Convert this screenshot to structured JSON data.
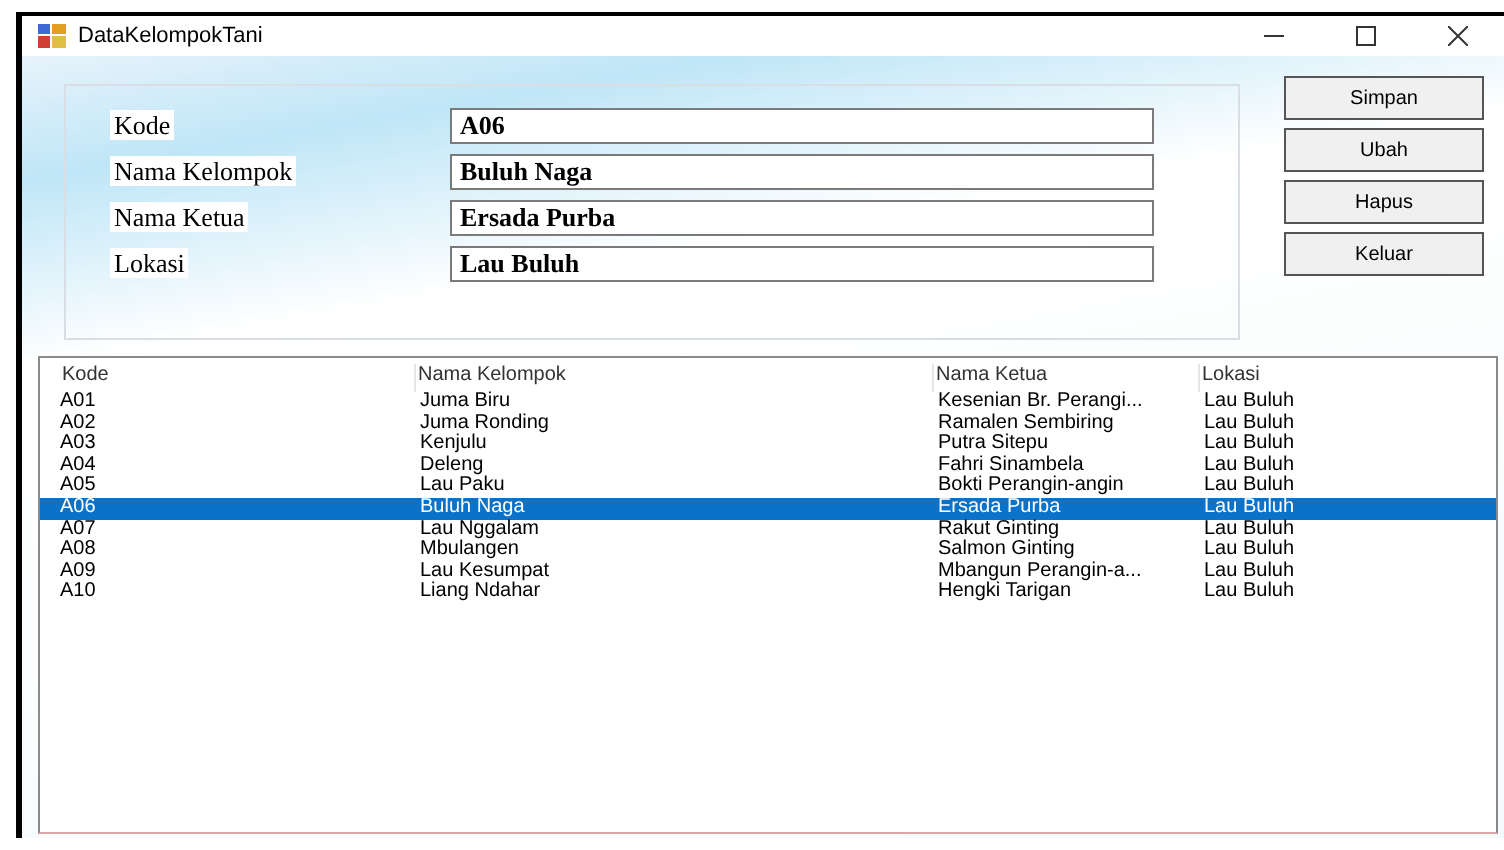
{
  "window": {
    "title": "DataKelompokTani"
  },
  "fields": [
    {
      "label": "Kode",
      "value": "A06"
    },
    {
      "label": "Nama Kelompok",
      "value": "Buluh Naga"
    },
    {
      "label": "Nama Ketua",
      "value": "Ersada Purba"
    },
    {
      "label": "Lokasi",
      "value": "Lau Buluh"
    }
  ],
  "buttons": [
    "Simpan",
    "Ubah",
    "Hapus",
    "Keluar"
  ],
  "table": {
    "columns": [
      "Kode",
      "Nama Kelompok",
      "Nama Ketua",
      "Lokasi"
    ],
    "rows": [
      {
        "cells": [
          "A01",
          "Juma Biru",
          "Kesenian Br. Perangi...",
          "Lau Buluh"
        ],
        "selected": false
      },
      {
        "cells": [
          "A02",
          "Juma Ronding",
          "Ramalen Sembiring",
          "Lau Buluh"
        ],
        "selected": false
      },
      {
        "cells": [
          "A03",
          "Kenjulu",
          "Putra Sitepu",
          "Lau Buluh"
        ],
        "selected": false
      },
      {
        "cells": [
          "A04",
          "Deleng",
          "Fahri Sinambela",
          "Lau Buluh"
        ],
        "selected": false
      },
      {
        "cells": [
          "A05",
          "Lau Paku",
          "Bokti Perangin-angin",
          "Lau Buluh"
        ],
        "selected": false
      },
      {
        "cells": [
          "A06",
          "Buluh Naga",
          "Ersada Purba",
          "Lau Buluh"
        ],
        "selected": true
      },
      {
        "cells": [
          "A07",
          "Lau Nggalam",
          "Rakut Ginting",
          "Lau Buluh"
        ],
        "selected": false
      },
      {
        "cells": [
          "A08",
          "Mbulangen",
          "Salmon Ginting",
          "Lau Buluh"
        ],
        "selected": false
      },
      {
        "cells": [
          "A09",
          "Lau Kesumpat",
          "Mbangun Perangin-a...",
          "Lau Buluh"
        ],
        "selected": false
      },
      {
        "cells": [
          "A10",
          "Liang Ndahar",
          "Hengki Tarigan",
          "Lau Buluh"
        ],
        "selected": false
      }
    ]
  }
}
